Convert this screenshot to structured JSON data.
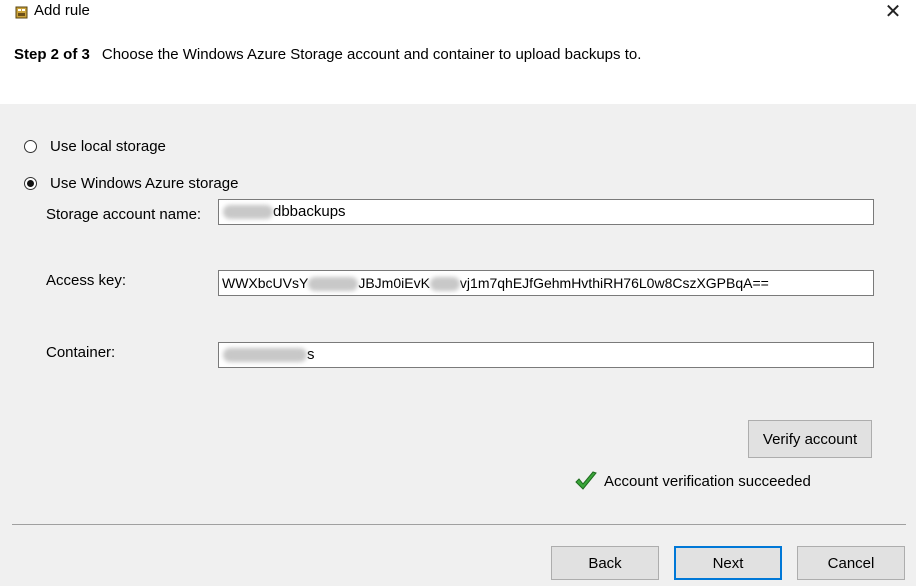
{
  "window": {
    "title": "Add rule",
    "close_glyph": "✕"
  },
  "header": {
    "step_label": "Step 2 of 3",
    "step_description": "Choose the Windows Azure Storage account and container to upload backups to."
  },
  "storage_options": {
    "local_label": "Use local storage",
    "azure_label": "Use Windows Azure storage",
    "selected": "azure"
  },
  "fields": {
    "account_name": {
      "label": "Storage account name:",
      "value_visible": "dbbackups"
    },
    "access_key": {
      "label": "Access key:",
      "value_start": "WWXbcUVsY",
      "value_mid": "JBJm0iEvK",
      "value_end": "vj1m7qhEJfGehmHvthiRH76L0w8CszXGPBqA=="
    },
    "container": {
      "label": "Container:",
      "value_visible": "s"
    }
  },
  "verify": {
    "button_label": "Verify account",
    "status_text": "Account verification succeeded",
    "status_color": "#3aa63a"
  },
  "footer": {
    "back_label": "Back",
    "next_label": "Next",
    "cancel_label": "Cancel",
    "accent": "#0078d7"
  }
}
